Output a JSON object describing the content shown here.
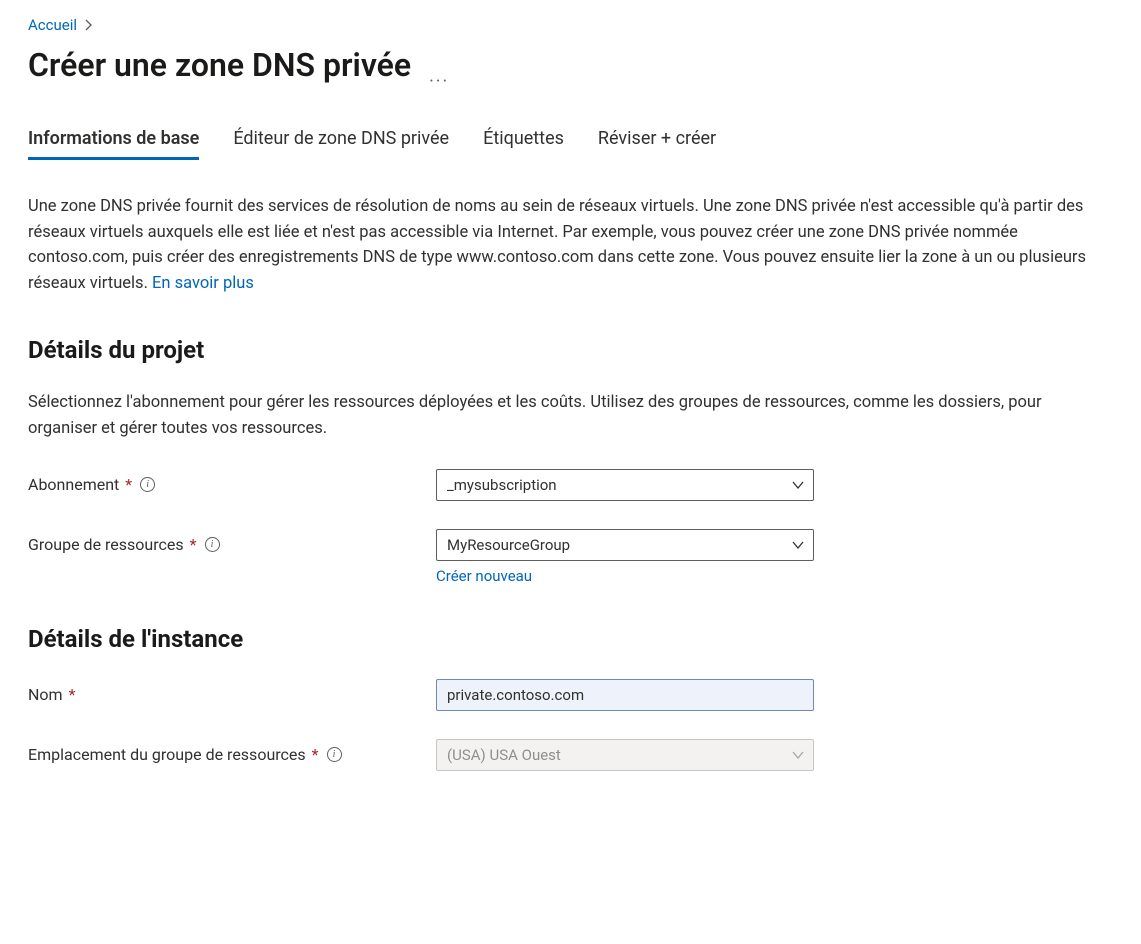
{
  "breadcrumb": {
    "home": "Accueil"
  },
  "header": {
    "title": "Créer une zone DNS privée"
  },
  "tabs": {
    "basics": "Informations de base",
    "editor": "Éditeur de zone DNS privée",
    "tags": "Étiquettes",
    "review": "Réviser + créer"
  },
  "intro": {
    "text": "Une zone DNS privée fournit des services de résolution de noms au sein de réseaux virtuels. Une zone DNS privée n'est accessible qu'à partir des réseaux virtuels auxquels elle est liée et n'est pas accessible via Internet. Par exemple, vous pouvez créer une zone DNS privée nommée contoso.com, puis créer des enregistrements DNS de type www.contoso.com dans cette zone. Vous pouvez ensuite lier la zone à un ou plusieurs réseaux virtuels. ",
    "learn_more": "En savoir plus"
  },
  "project": {
    "heading": "Détails du projet",
    "desc": "Sélectionnez l'abonnement pour gérer les ressources déployées et les coûts. Utilisez des groupes de ressources, comme les dossiers, pour organiser et gérer toutes vos ressources.",
    "subscription_label": "Abonnement",
    "subscription_value": "_mysubscription",
    "rg_label": "Groupe de ressources",
    "rg_value": "MyResourceGroup",
    "create_new": "Créer nouveau"
  },
  "instance": {
    "heading": "Détails de l'instance",
    "name_label": "Nom",
    "name_value": "private.contoso.com",
    "location_label": "Emplacement du groupe de ressources",
    "location_value": "(USA) USA Ouest"
  }
}
